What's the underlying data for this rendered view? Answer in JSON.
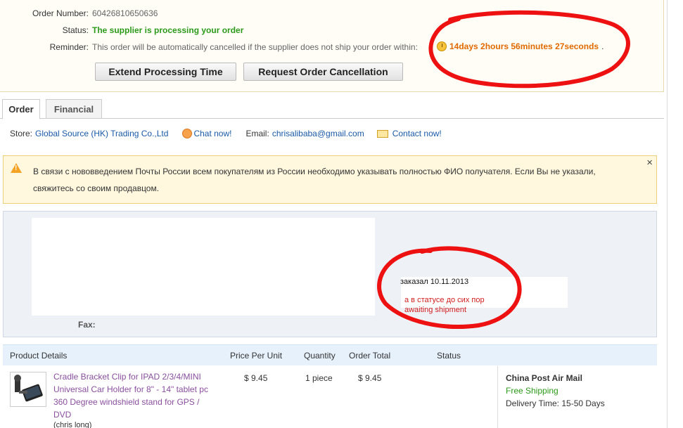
{
  "order": {
    "number_label": "Order Number:",
    "number": "60426810650636",
    "status_label": "Status:",
    "status": "The supplier is processing your order",
    "reminder_label": "Reminder:",
    "reminder": "This order will be automatically cancelled if the supplier does not ship your order within:",
    "countdown": "14days 2hours 56minutes 27seconds",
    "countdown_tail": "."
  },
  "buttons": {
    "extend": "Extend Processing Time",
    "cancel": "Request Order Cancellation"
  },
  "tabs": [
    {
      "label": "Order"
    },
    {
      "label": "Financial"
    }
  ],
  "store": {
    "label": "Store:",
    "name": "Global Source (HK) Trading Co.,Ltd",
    "chat": "Chat now!",
    "email_label": "Email:",
    "email": "chrisalibaba@gmail.com",
    "contact": "Contact now!"
  },
  "warning": {
    "text": "В связи с нововведением Почты России всем покупателям из России необходимо указывать полностью ФИО получателя. Если Вы не указали, свяжитесь со своим продавцом.",
    "close": "×"
  },
  "address": {
    "fax_label": "Fax:",
    "note_date": "заказал 10.11.2013",
    "note_line1": "а в статусе до сих пор",
    "note_line2": "awaiting shipment"
  },
  "table": {
    "headers": [
      "Product Details",
      "Price Per Unit",
      "Quantity",
      "Order Total",
      "Status"
    ],
    "rows": [
      {
        "product": "Cradle Bracket Clip for IPAD 2/3/4/MINI Universal Car Holder for 8\" - 14\" tablet pc 360 Degree windshield stand for GPS / DVD",
        "seller": "(chris long)",
        "price": "$ 9.45",
        "quantity": "1 piece",
        "total": "$ 9.45",
        "status": ""
      }
    ]
  },
  "shipping": {
    "method": "China Post Air Mail",
    "cost": "Free Shipping",
    "time_label": "Delivery Time:",
    "time": "15-50 Days"
  },
  "colors": {
    "status_green": "#2c9a1a",
    "countdown_orange": "#e06a00",
    "link_blue": "#1a5aa8",
    "annotation_red": "#ee1111"
  }
}
